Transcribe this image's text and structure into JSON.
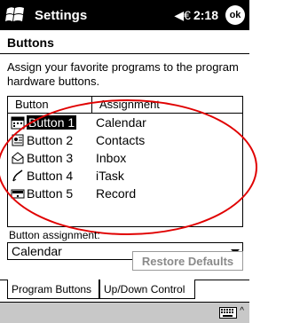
{
  "titlebar": {
    "title": "Settings",
    "volume_icon": "◀€",
    "time": "2:18",
    "ok_label": "ok"
  },
  "page": {
    "heading": "Buttons",
    "instructions": "Assign your favorite programs to the program hardware buttons."
  },
  "listview": {
    "columns": [
      "Button",
      "Assignment"
    ],
    "rows": [
      {
        "button": "Button 1",
        "assignment": "Calendar",
        "icon": "calendar-icon",
        "selected": true
      },
      {
        "button": "Button 2",
        "assignment": "Contacts",
        "icon": "contacts-icon",
        "selected": false
      },
      {
        "button": "Button 3",
        "assignment": "Inbox",
        "icon": "inbox-icon",
        "selected": false
      },
      {
        "button": "Button 4",
        "assignment": "iTask",
        "icon": "itask-icon",
        "selected": false
      },
      {
        "button": "Button 5",
        "assignment": "Record",
        "icon": "record-icon",
        "selected": false
      }
    ]
  },
  "assignment": {
    "label": "Button assignment:",
    "value": "Calendar"
  },
  "restore_label": "Restore Defaults",
  "tabs": [
    {
      "label": "Program Buttons",
      "active": true
    },
    {
      "label": "Up/Down Control",
      "active": false
    }
  ],
  "bottombar": {
    "keyboard_icon": "keyboard-icon",
    "caret": "^"
  },
  "colors": {
    "titlebar_bg": "#000000",
    "annotation": "#e00000",
    "disabled_text": "#8a8a8a"
  }
}
